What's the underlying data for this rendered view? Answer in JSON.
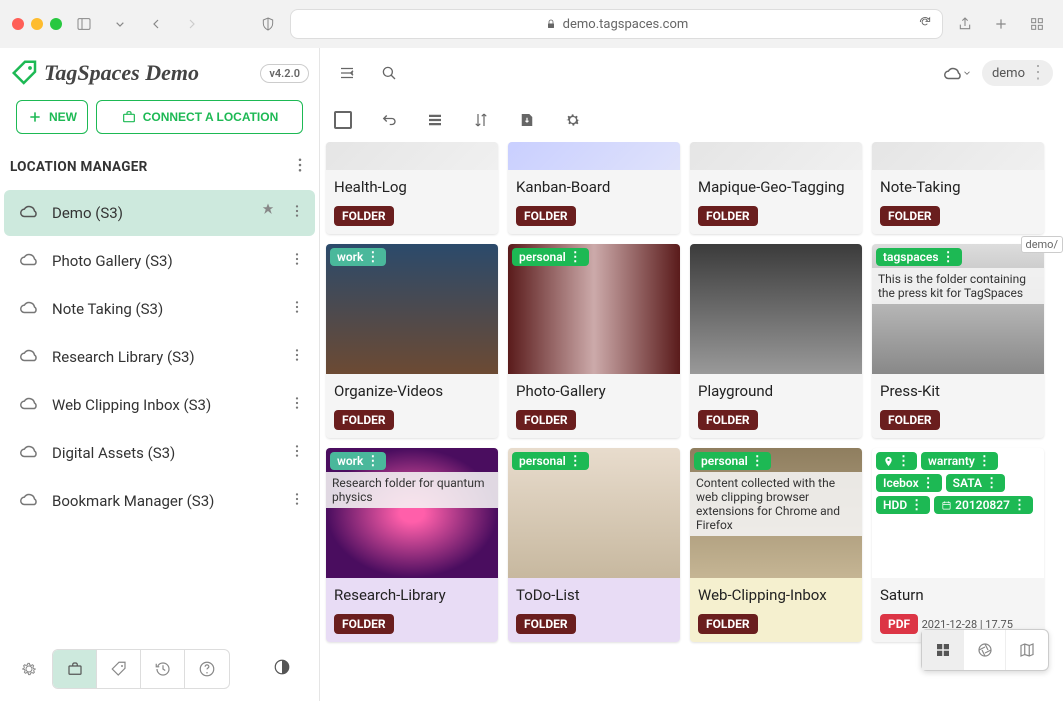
{
  "browser": {
    "url_host": "demo.tagspaces.com"
  },
  "app": {
    "title": "TagSpaces Demo",
    "version": "v4.2.0"
  },
  "sidebar": {
    "new_label": "NEW",
    "connect_label": "CONNECT A LOCATION",
    "section_title": "LOCATION MANAGER",
    "locations": [
      {
        "label": "Demo (S3)",
        "active": true
      },
      {
        "label": "Photo Gallery (S3)",
        "active": false
      },
      {
        "label": "Note Taking (S3)",
        "active": false
      },
      {
        "label": "Research Library (S3)",
        "active": false
      },
      {
        "label": "Web Clipping Inbox (S3)",
        "active": false
      },
      {
        "label": "Digital Assets (S3)",
        "active": false
      },
      {
        "label": "Bookmark Manager (S3)",
        "active": false
      }
    ]
  },
  "main": {
    "location_chip": "demo",
    "scroll_label": "demo/",
    "badge_folder": "FOLDER",
    "badge_pdf": "PDF",
    "cards": [
      {
        "title": "Health-Log",
        "badge": "FOLDER",
        "thumb": "grey"
      },
      {
        "title": "Kanban-Board",
        "badge": "FOLDER",
        "thumb": "blue"
      },
      {
        "title": "Mapique-Geo-Tagging",
        "badge": "FOLDER",
        "thumb": "grey"
      },
      {
        "title": "Note-Taking",
        "badge": "FOLDER",
        "thumb": "grey"
      },
      {
        "title": "Organize-Videos",
        "badge": "FOLDER",
        "thumb": "rocks",
        "tags": [
          "work"
        ]
      },
      {
        "title": "Photo-Gallery",
        "badge": "FOLDER",
        "thumb": "city",
        "tags": [
          "personal"
        ]
      },
      {
        "title": "Playground",
        "badge": "FOLDER",
        "thumb": "type"
      },
      {
        "title": "Press-Kit",
        "badge": "FOLDER",
        "thumb": "press",
        "tags": [
          "tagspaces"
        ],
        "overlay": "This is the folder containing the press kit for TagSpaces"
      },
      {
        "title": "Research-Library",
        "badge": "FOLDER",
        "thumb": "plasma",
        "tags": [
          "work"
        ],
        "body": "lav",
        "overlay": "Research folder for quantum physics"
      },
      {
        "title": "ToDo-List",
        "badge": "FOLDER",
        "thumb": "notebook",
        "tags": [
          "personal"
        ],
        "body": "lav"
      },
      {
        "title": "Web-Clipping-Inbox",
        "badge": "FOLDER",
        "thumb": "shelf",
        "tags": [
          "personal"
        ],
        "body": "yel",
        "overlay": "Content collected with the web clipping browser extensions for Chrome and Firefox"
      },
      {
        "title": "Saturn",
        "badge": "PDF",
        "thumb": "receipt",
        "tags_geo": true,
        "tags": [
          "warranty",
          "Icebox",
          "SATA",
          "HDD",
          "20120827"
        ],
        "meta": "2021-12-28 | 17.75"
      }
    ]
  }
}
